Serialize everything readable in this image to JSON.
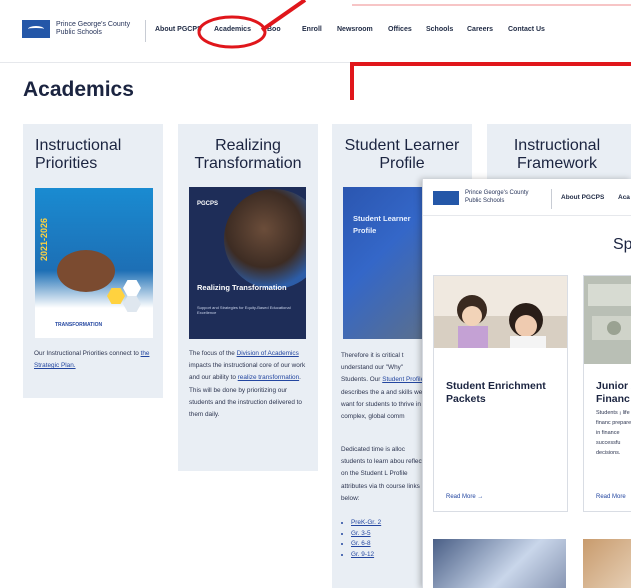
{
  "header": {
    "logo_line1": "Prince George's County",
    "logo_line2": "Public Schools",
    "nav": [
      "About PGCPS",
      "Academics",
      "Boo",
      "Enroll",
      "Newsroom",
      "Offices",
      "Schools",
      "Careers",
      "Contact Us"
    ]
  },
  "page": {
    "title": "Academics"
  },
  "cards": [
    {
      "title": "Instructional Priorities",
      "cover": {
        "year": "2021-2026",
        "caption": "TRANSFORMATION"
      },
      "text_before": "Our Instructional Priorities connect to ",
      "link": "the Strategic Plan."
    },
    {
      "title": "Realizing Transformation",
      "cover": {
        "brand": "PGCPS",
        "title": "Realizing Transformation",
        "subtitle": "Support and Strategies for Equity-Based Educational Excellence"
      },
      "text_a": "The focus of the ",
      "link_a": "Division of Academics",
      "text_b": " impacts the instructional core of our work and our ability to ",
      "link_b": "realize transformation",
      "text_c": ". This will be done by prioritizing our students and the instruction delivered to them daily."
    },
    {
      "title": "Student Learner Profile",
      "cover": {
        "title": "Student Learner Profile"
      },
      "p1_before": "Therefore it is critical t understand our \"Why\" Students. Our ",
      "p1_link": "Student Profile",
      "p1_after": " describes the a and skills we want for students to thrive in a complex, global comm",
      "p2": "Dedicated time is alloc students to learn abou reflect on the Student L Profile attributes via th course links below:",
      "links": [
        "PreK-Gr. 2",
        "Gr. 3-5",
        "Gr. 6-8",
        "Gr. 9-12"
      ]
    },
    {
      "title": "Instructional Framework"
    }
  ],
  "overlay": {
    "logo_line1": "Prince George's County",
    "logo_line2": "Public Schools",
    "nav_item": "About PGCPS",
    "nav_cut": "Aca",
    "heading_cut": "Sp",
    "card1": {
      "title": "Student Enrichment Packets",
      "readmore": "Read More"
    },
    "card2": {
      "title_line1": "Junior A",
      "title_line2": "Financ",
      "text": "Students ¡ life financ prepare fo in finance successfu decisions.",
      "readmore": "Read More"
    }
  },
  "colors": {
    "annotation_red": "#e0161b",
    "brand_blue": "#2457a8",
    "link_blue": "#2346a0"
  }
}
